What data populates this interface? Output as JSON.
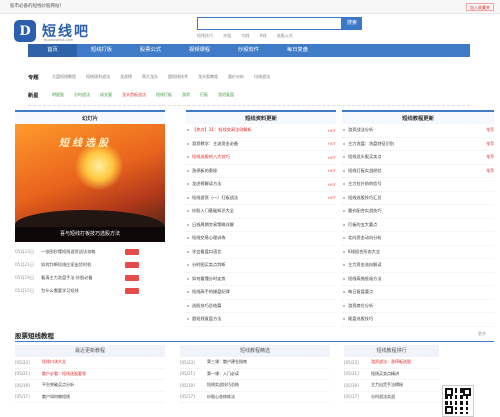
{
  "top_bar": {
    "welcome": "股市必备的短线炒股网站！",
    "favorite": "加入收藏夹"
  },
  "logo": {
    "badge": "D",
    "name": "短线吧",
    "sub": "duanxianba.com"
  },
  "search": {
    "placeholder": "",
    "button": "搜索",
    "hot": [
      "短线技巧",
      "炒股",
      "均线",
      "K线",
      "选股公式"
    ]
  },
  "nav": [
    "首页",
    "短线打板",
    "股票公式",
    "视频课程",
    "炒股软件",
    "每日复盘"
  ],
  "topics": {
    "zhuanti_label": "专题",
    "zhuanti": [
      "大盘短线教程",
      "短线逐利战法",
      "龙虎榜",
      "两大龙头",
      "超短线技术",
      "龙头股教程",
      "量价分析",
      "均线战法"
    ],
    "xinde_label": "新星",
    "xinde": [
      "明星股",
      "分时战法",
      "成交量",
      "龙头首板战法",
      "短线打板",
      "游资",
      "打板",
      "游资复盘"
    ]
  },
  "slides": {
    "title": "幻灯片",
    "heading": "短线选股",
    "caption": "喜与短线打板技巧选股方法",
    "list": [
      {
        "date": "05月23日",
        "text": "一张图秒懂短线游资战法攻略",
        "tag": true
      },
      {
        "date": "05月21日",
        "text": "如何判断短线庄家出货时机",
        "tag": true
      },
      {
        "date": "05月19日",
        "text": "看清主力洗盘手法·炒股必备",
        "tag": true
      },
      {
        "date": "05月15日",
        "text": "为什么需要学习短线",
        "tag": true
      }
    ]
  },
  "middle": {
    "title": "短线资料更新",
    "items": [
      {
        "text": "【热点】11：短线交易法则解析",
        "red": true,
        "flag": "HOT"
      },
      {
        "text": "游资教学：主流资金必备",
        "red": false,
        "flag": "HOT"
      },
      {
        "text": "短线选股的八大技巧",
        "red": true,
        "flag": "HOT"
      },
      {
        "text": "涨停板的奥秘",
        "red": false,
        "flag": "HOT"
      },
      {
        "text": "龙虎榜解读方法",
        "red": false,
        "flag": "HOT"
      },
      {
        "text": "短线游资（一）打板战法",
        "red": false,
        "flag": "HOT"
      },
      {
        "text": "炒股入门基础知识大全",
        "red": false,
        "flag": ""
      },
      {
        "text": "日线周期交易策略详解",
        "red": false,
        "flag": ""
      },
      {
        "text": "短线交易心理训练",
        "red": false,
        "flag": ""
      },
      {
        "text": "学会看盘口语言",
        "red": false,
        "flag": ""
      },
      {
        "text": "分时图买卖点判断",
        "red": false,
        "flag": ""
      },
      {
        "text": "如何看懂分时走势",
        "red": false,
        "flag": ""
      },
      {
        "text": "短线高手的操盘纪律",
        "red": false,
        "flag": ""
      },
      {
        "text": "选股技巧总结篇",
        "red": false,
        "flag": ""
      },
      {
        "text": "超短线复盘方法",
        "red": false,
        "flag": ""
      }
    ]
  },
  "right": {
    "title": "短线教程更新",
    "items": [
      {
        "text": "游资战法分析",
        "tag": "推荐"
      },
      {
        "text": "主力洗盘：洗盘特征识别",
        "tag": "推荐"
      },
      {
        "text": "短线龙头股买卖点",
        "tag": "推荐"
      },
      {
        "text": "短线打板实战经验",
        "tag": "推荐"
      },
      {
        "text": "主力拉升前的信号",
        "tag": ""
      },
      {
        "text": "短线选股技巧汇总",
        "tag": ""
      },
      {
        "text": "量价配合实战技巧",
        "tag": ""
      },
      {
        "text": "打板的五大要点",
        "tag": ""
      },
      {
        "text": "北向资金动向分析",
        "tag": ""
      },
      {
        "text": "K线组合形态大全",
        "tag": ""
      },
      {
        "text": "主力资金流向解读",
        "tag": ""
      },
      {
        "text": "短线高抛低吸方法",
        "tag": ""
      },
      {
        "text": "每日复盘要点",
        "tag": ""
      },
      {
        "text": "游资席位分析",
        "tag": ""
      },
      {
        "text": "尾盘选股技巧",
        "tag": ""
      }
    ]
  },
  "bottom": {
    "title": "股票短线教程",
    "more": "更多",
    "cols": [
      {
        "head": "最近更新教程",
        "items": [
          {
            "date": "[05/23]",
            "text": "短线口诀大全",
            "red": true
          },
          {
            "date": "[05/21]",
            "text": "散户必看：短线选股要领",
            "red": true
          },
          {
            "date": "[05/19]",
            "text": "平台突破买点分析",
            "red": false
          },
          {
            "date": "[05/17]",
            "text": "散户如何做短线",
            "red": false
          }
        ]
      },
      {
        "head": "短线教程精选",
        "items": [
          {
            "date": "[05/23]",
            "text": "第三课：散户建仓指南",
            "red": false
          },
          {
            "date": "[05/21]",
            "text": "第一课：入门必读",
            "red": false
          },
          {
            "date": "[05/19]",
            "text": "短线实战技巧总结",
            "red": false
          },
          {
            "date": "[05/17]",
            "text": "炒股心态修炼法",
            "red": false
          }
        ]
      },
      {
        "head": "短线教程排行",
        "items": [
          {
            "date": "[05/23]",
            "text": "游资战法：涨停板选股",
            "red": true
          },
          {
            "date": "[05/21]",
            "text": "短线买卖点精讲",
            "red": false
          },
          {
            "date": "[05/19]",
            "text": "主力出货手法揭秘",
            "red": false
          },
          {
            "date": "[05/17]",
            "text": "分时战法实战",
            "red": false
          }
        ]
      }
    ]
  },
  "colors": {
    "primary": "#3f7bc6",
    "accent_red": "#e74c4c"
  }
}
